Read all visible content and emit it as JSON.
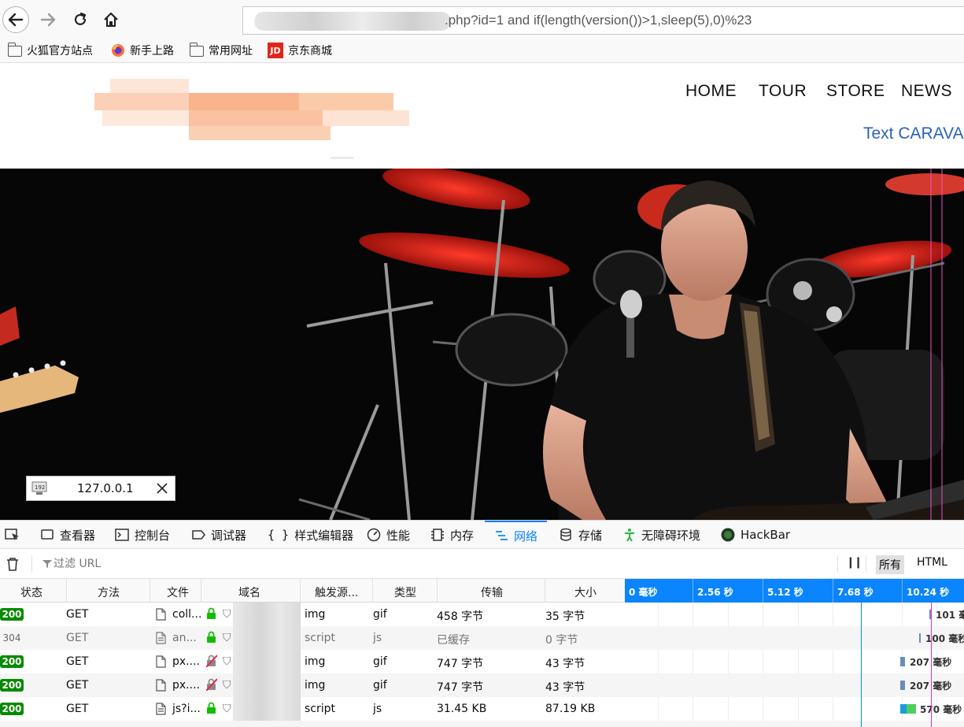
{
  "browser": {
    "url": ".php?id=1 and if(length(version())>1,sleep(5),0)%23",
    "bookmarks": [
      {
        "label": "火狐官方站点",
        "icon": "folder-icon"
      },
      {
        "label": "新手上路",
        "icon": "firefox-icon"
      },
      {
        "label": "常用网址",
        "icon": "folder-icon"
      },
      {
        "label": "京东商城",
        "icon": "jd-icon",
        "badge": "JD"
      }
    ]
  },
  "site": {
    "menu": [
      "HOME",
      "TOUR",
      "STORE",
      "NEWS"
    ],
    "caravan": "Text CARAVA"
  },
  "ip_popup": {
    "ip": "127.0.0.1"
  },
  "devtools": {
    "tabs": [
      {
        "label": "查看器",
        "icon": "inspector-icon"
      },
      {
        "label": "控制台",
        "icon": "console-icon"
      },
      {
        "label": "调试器",
        "icon": "debugger-icon"
      },
      {
        "label": "样式编辑器",
        "icon": "style-editor-icon"
      },
      {
        "label": "性能",
        "icon": "performance-icon"
      },
      {
        "label": "内存",
        "icon": "memory-icon"
      },
      {
        "label": "网络",
        "icon": "network-icon",
        "active": true
      },
      {
        "label": "存储",
        "icon": "storage-icon"
      },
      {
        "label": "无障碍环境",
        "icon": "accessibility-icon"
      },
      {
        "label": "HackBar",
        "icon": "hackbar-icon"
      }
    ],
    "filter_placeholder": "过滤 URL",
    "filter_types": [
      "所有",
      "HTML"
    ],
    "pause_label": "❙❙",
    "columns": [
      "状态",
      "方法",
      "文件",
      "域名",
      "触发源...",
      "类型",
      "传输",
      "大小"
    ],
    "timeline_labels": [
      "0 毫秒",
      "2.56 秒",
      "5.12 秒",
      "7.68 秒",
      "10.24 秒"
    ],
    "requests": [
      {
        "status": "200",
        "method": "GET",
        "file": "coll...",
        "cause": "img",
        "type": "gif",
        "transferred": "458 字节",
        "size": "35 字节",
        "time": "101 毫",
        "cached": false
      },
      {
        "status": "304",
        "method": "GET",
        "file": "an...",
        "cause": "script",
        "type": "js",
        "transferred": "已缓存",
        "size": "0 字节",
        "time": "100 毫秒",
        "cached": true
      },
      {
        "status": "200",
        "method": "GET",
        "file": "px....",
        "cause": "img",
        "type": "gif",
        "transferred": "747 字节",
        "size": "43 字节",
        "time": "207 毫秒",
        "cached": false
      },
      {
        "status": "200",
        "method": "GET",
        "file": "px....",
        "cause": "img",
        "type": "gif",
        "transferred": "747 字节",
        "size": "43 字节",
        "time": "207 毫秒",
        "cached": false
      },
      {
        "status": "200",
        "method": "GET",
        "file": "js?i...",
        "cause": "script",
        "type": "js",
        "transferred": "31.45 KB",
        "size": "87.19 KB",
        "time": "570 毫秒",
        "cached": false
      }
    ]
  },
  "colors": {
    "accent": "#0a84ff",
    "status_ok": "#058b00",
    "caravan_link": "#2a62b5"
  }
}
